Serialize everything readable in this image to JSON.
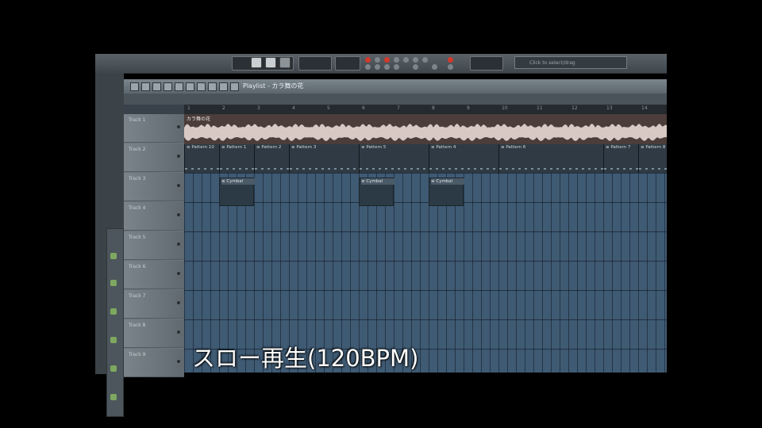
{
  "caption": "スロー再生(120BPM)",
  "playlist": {
    "title": "Playlist - カラ舞の花",
    "ruler": [
      "1",
      "2",
      "3",
      "4",
      "5",
      "6",
      "7",
      "8",
      "9",
      "10",
      "11",
      "12",
      "13",
      "14"
    ],
    "tracks": [
      "Track 1",
      "Track 2",
      "Track 3",
      "Track 4",
      "Track 5",
      "Track 6",
      "Track 7",
      "Track 8",
      "Track 9"
    ],
    "audio_clip_label": "カラ舞の花",
    "patterns": [
      "Pattern 10",
      "Pattern 1",
      "Pattern 2",
      "Pattern 3",
      "Pattern 5",
      "Pattern 4",
      "Pattern 6",
      "Pattern 7",
      "Pattern 8"
    ],
    "cymbal_label": "Cymbal"
  },
  "toolbar": {
    "hint": "Click to select/drag",
    "colors": {
      "record": "#d23a2c",
      "panel": "#2b3034"
    }
  }
}
